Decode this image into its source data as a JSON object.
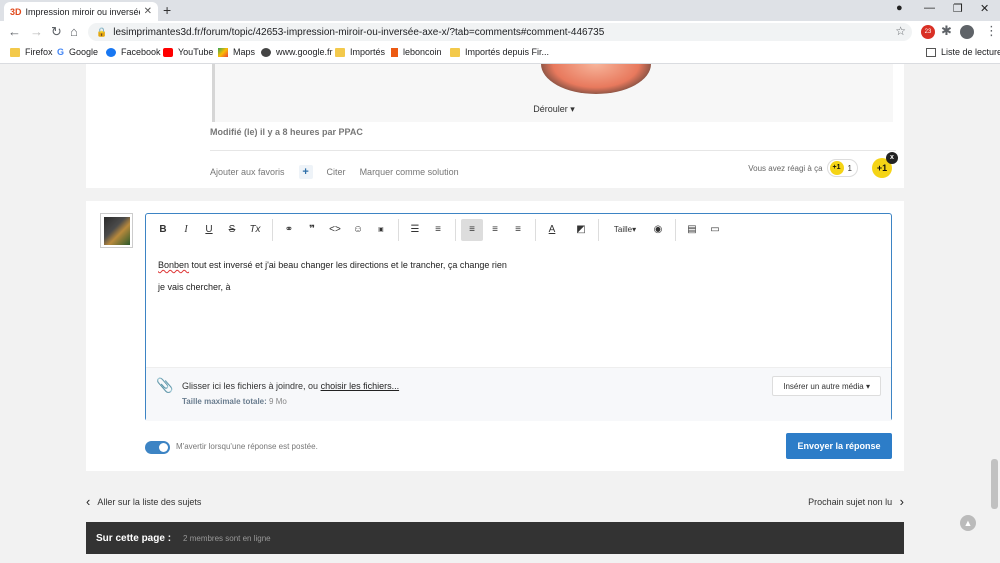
{
  "browser": {
    "tab_icon": "3D",
    "tab_title": "Impression miroir ou inversée Axe",
    "url": "lesimprimantes3d.fr/forum/topic/42653-impression-miroir-ou-inversée-axe-x/?tab=comments#comment-446735",
    "ext_badge": "23",
    "bookmarks": [
      "Firefox",
      "Google",
      "Facebook",
      "YouTube",
      "Maps",
      "www.google.fr",
      "Importés",
      "leboncoin",
      "Importés depuis Fir..."
    ],
    "reading_list": "Liste de lecture"
  },
  "post": {
    "derouler": "Dérouler",
    "modified": "Modifié (le) il y a 8 heures par PPAC",
    "actions": [
      "Ajouter aux favoris",
      "+",
      "Citer",
      "Marquer comme solution"
    ],
    "reacted_label": "Vous avez réagi à ça",
    "reaction_icon": "+1",
    "reaction_count": "1",
    "close_badge": "x"
  },
  "editor": {
    "size_label": "Taille",
    "line1_word1": "Bonben",
    "line1_rest": " tout est inversé et j'ai beau changer les directions et le trancher, ça change rien",
    "line2": "je vais chercher, à",
    "attach_prefix": "Glisser ici les fichiers à joindre, ou ",
    "attach_link": "choisir les fichiers...",
    "max_label": "Taille maximale totale:",
    "max_value": "9 Mo",
    "media_button": "Insérer un autre média"
  },
  "reply": {
    "notify_label": "M'avertir lorsqu'une réponse est postée.",
    "send_button": "Envoyer la réponse"
  },
  "nav": {
    "prev": "Aller sur la liste des sujets",
    "next": "Prochain sujet non lu"
  },
  "footer": {
    "title": "Sur cette page :",
    "subtitle": "2 membres sont en ligne"
  },
  "colors": {
    "accent": "#2d7dc8",
    "reaction": "#f5d416",
    "footer": "#333333"
  }
}
